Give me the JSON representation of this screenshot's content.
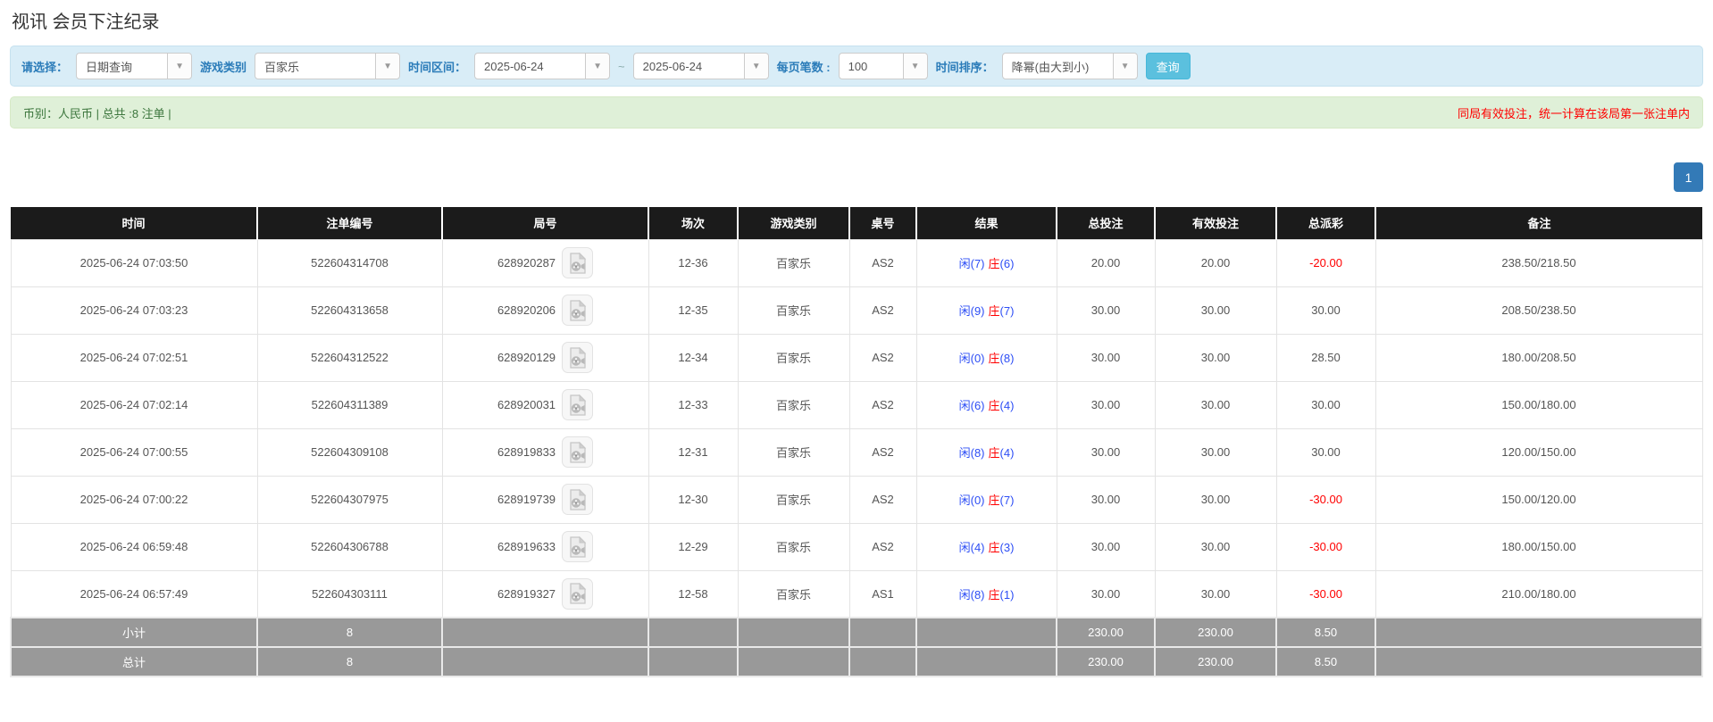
{
  "page": {
    "title": "视讯 会员下注纪录"
  },
  "filters": {
    "select_label": "请选择：",
    "select_value": "日期查询",
    "game_type_label": "游戏类别",
    "game_type_value": "百家乐",
    "time_range_label": "时间区间：",
    "date_from": "2025-06-24",
    "date_separator": "~",
    "date_to": "2025-06-24",
    "page_size_label": "每页笔数 :",
    "page_size_value": "100",
    "sort_label": "时间排序：",
    "sort_value": "降幂(由大到小)",
    "search_button": "查询"
  },
  "summary": {
    "left": "币别：人民币 | 总共 :8 注单 |",
    "right": "同局有效投注，统一计算在该局第一张注单内"
  },
  "pagination": {
    "current": "1"
  },
  "table": {
    "headers": [
      "时间",
      "注单编号",
      "局号",
      "场次",
      "游戏类别",
      "桌号",
      "结果",
      "总投注",
      "有效投注",
      "总派彩",
      "备注"
    ],
    "rows": [
      {
        "time": "2025-06-24 07:03:50",
        "bet_id": "522604314708",
        "round_id": "628920287",
        "session": "12-36",
        "game": "百家乐",
        "table_no": "AS2",
        "result_player": "闲",
        "result_player_pts": "(7)",
        "result_banker": "庄",
        "result_banker_pts": "(6)",
        "total_bet": "20.00",
        "valid_bet": "20.00",
        "payout": "-20.00",
        "remark": "238.50/218.50"
      },
      {
        "time": "2025-06-24 07:03:23",
        "bet_id": "522604313658",
        "round_id": "628920206",
        "session": "12-35",
        "game": "百家乐",
        "table_no": "AS2",
        "result_player": "闲",
        "result_player_pts": "(9)",
        "result_banker": "庄",
        "result_banker_pts": "(7)",
        "total_bet": "30.00",
        "valid_bet": "30.00",
        "payout": "30.00",
        "remark": "208.50/238.50"
      },
      {
        "time": "2025-06-24 07:02:51",
        "bet_id": "522604312522",
        "round_id": "628920129",
        "session": "12-34",
        "game": "百家乐",
        "table_no": "AS2",
        "result_player": "闲",
        "result_player_pts": "(0)",
        "result_banker": "庄",
        "result_banker_pts": "(8)",
        "total_bet": "30.00",
        "valid_bet": "30.00",
        "payout": "28.50",
        "remark": "180.00/208.50"
      },
      {
        "time": "2025-06-24 07:02:14",
        "bet_id": "522604311389",
        "round_id": "628920031",
        "session": "12-33",
        "game": "百家乐",
        "table_no": "AS2",
        "result_player": "闲",
        "result_player_pts": "(6)",
        "result_banker": "庄",
        "result_banker_pts": "(4)",
        "total_bet": "30.00",
        "valid_bet": "30.00",
        "payout": "30.00",
        "remark": "150.00/180.00"
      },
      {
        "time": "2025-06-24 07:00:55",
        "bet_id": "522604309108",
        "round_id": "628919833",
        "session": "12-31",
        "game": "百家乐",
        "table_no": "AS2",
        "result_player": "闲",
        "result_player_pts": "(8)",
        "result_banker": "庄",
        "result_banker_pts": "(4)",
        "total_bet": "30.00",
        "valid_bet": "30.00",
        "payout": "30.00",
        "remark": "120.00/150.00"
      },
      {
        "time": "2025-06-24 07:00:22",
        "bet_id": "522604307975",
        "round_id": "628919739",
        "session": "12-30",
        "game": "百家乐",
        "table_no": "AS2",
        "result_player": "闲",
        "result_player_pts": "(0)",
        "result_banker": "庄",
        "result_banker_pts": "(7)",
        "total_bet": "30.00",
        "valid_bet": "30.00",
        "payout": "-30.00",
        "remark": "150.00/120.00"
      },
      {
        "time": "2025-06-24 06:59:48",
        "bet_id": "522604306788",
        "round_id": "628919633",
        "session": "12-29",
        "game": "百家乐",
        "table_no": "AS2",
        "result_player": "闲",
        "result_player_pts": "(4)",
        "result_banker": "庄",
        "result_banker_pts": "(3)",
        "total_bet": "30.00",
        "valid_bet": "30.00",
        "payout": "-30.00",
        "remark": "180.00/150.00"
      },
      {
        "time": "2025-06-24 06:57:49",
        "bet_id": "522604303111",
        "round_id": "628919327",
        "session": "12-58",
        "game": "百家乐",
        "table_no": "AS1",
        "result_player": "闲",
        "result_player_pts": "(8)",
        "result_banker": "庄",
        "result_banker_pts": "(1)",
        "total_bet": "30.00",
        "valid_bet": "30.00",
        "payout": "-30.00",
        "remark": "210.00/180.00"
      }
    ],
    "subtotal": {
      "label": "小计",
      "count": "8",
      "total_bet": "230.00",
      "valid_bet": "230.00",
      "payout": "8.50"
    },
    "total": {
      "label": "总计",
      "count": "8",
      "total_bet": "230.00",
      "valid_bet": "230.00",
      "payout": "8.50"
    }
  }
}
